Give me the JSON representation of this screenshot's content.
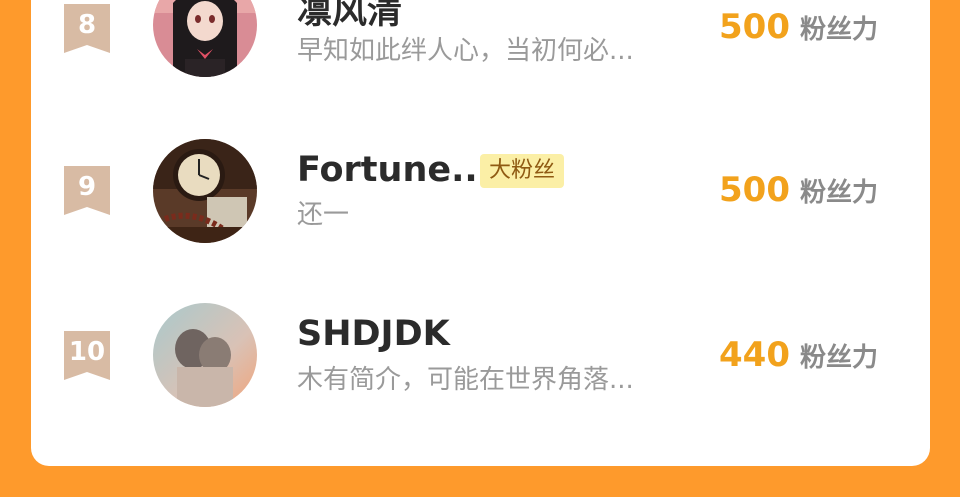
{
  "entries": [
    {
      "rank": "8",
      "name": "凛风清",
      "badge": "",
      "bio": "早知如此绊人心，当初何必...",
      "score": "500",
      "unit": "粉丝力",
      "avatar": "anime-girl-avatar"
    },
    {
      "rank": "9",
      "name": "Fortune...",
      "badge": "大粉丝",
      "bio": "还一",
      "score": "500",
      "unit": "粉丝力",
      "avatar": "clock-avatar"
    },
    {
      "rank": "10",
      "name": "SHDJDK",
      "badge": "",
      "bio": "木有简介，可能在世界角落...",
      "score": "440",
      "unit": "粉丝力",
      "avatar": "couple-photo-avatar"
    }
  ],
  "colors": {
    "background": "#FE9A2C",
    "score": "#F2A21C",
    "badge_bg": "#FBEFA6",
    "rank_flag": "#D8BBA4"
  }
}
